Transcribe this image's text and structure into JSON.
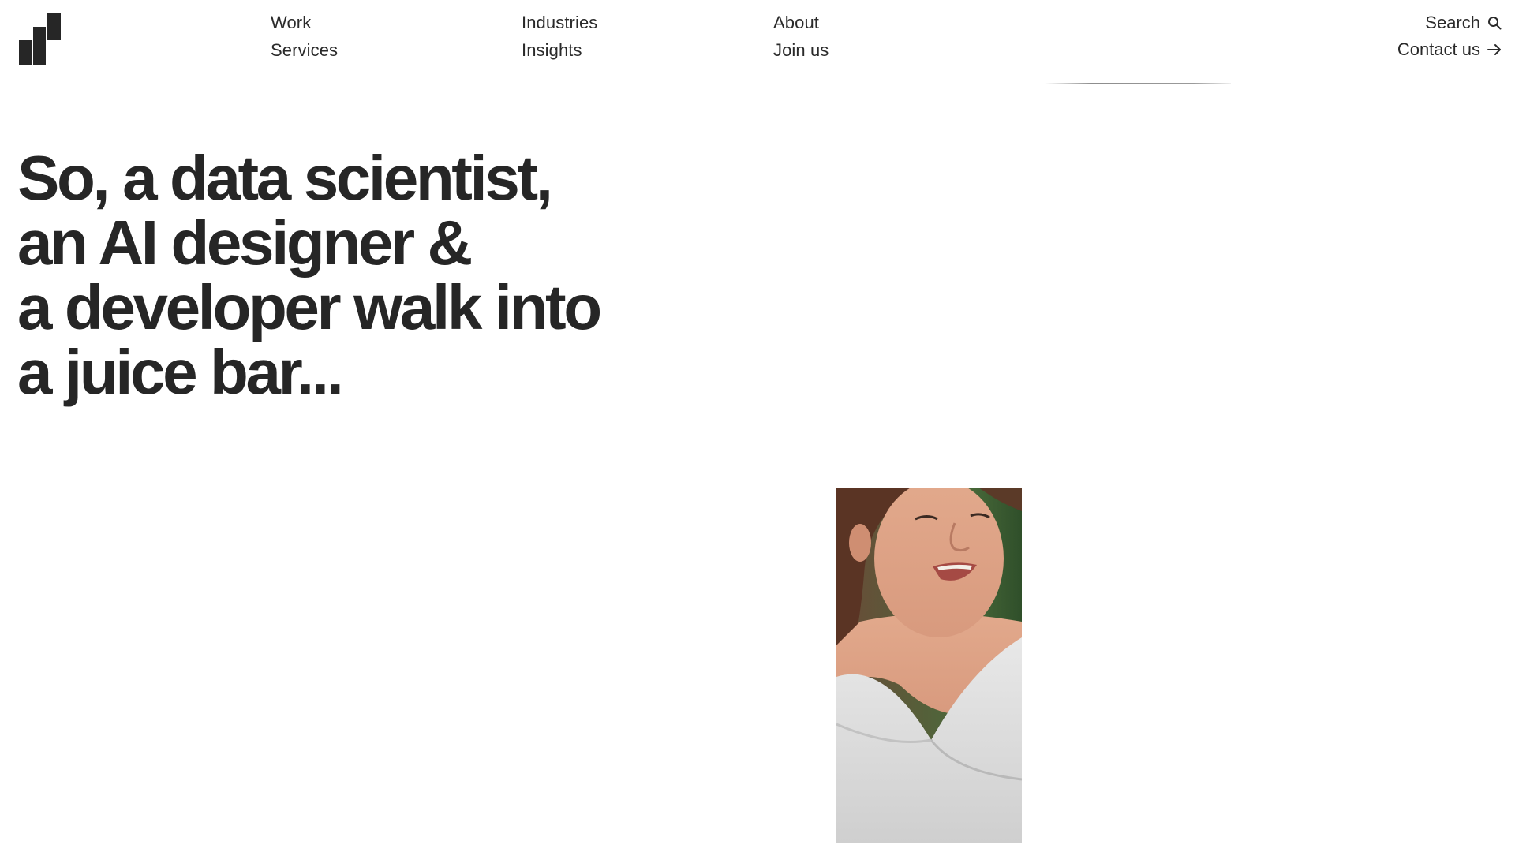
{
  "header": {
    "logo_icon": "brand-bars-logo",
    "nav": {
      "work": "Work",
      "services": "Services",
      "industries": "Industries",
      "insights": "Insights",
      "about": "About",
      "join_us": "Join us"
    },
    "utility": {
      "search_label": "Search",
      "search_icon": "search-icon",
      "contact_label": "Contact us",
      "contact_icon": "arrow-right-icon"
    }
  },
  "hero": {
    "title_lines": [
      "So, a data scientist,",
      "an AI designer &",
      "a developer walk into",
      "a juice bar..."
    ],
    "media": "video-still-woman-smiling"
  },
  "colors": {
    "background": "#ffffff",
    "text": "#262626",
    "logo": "#262626"
  }
}
